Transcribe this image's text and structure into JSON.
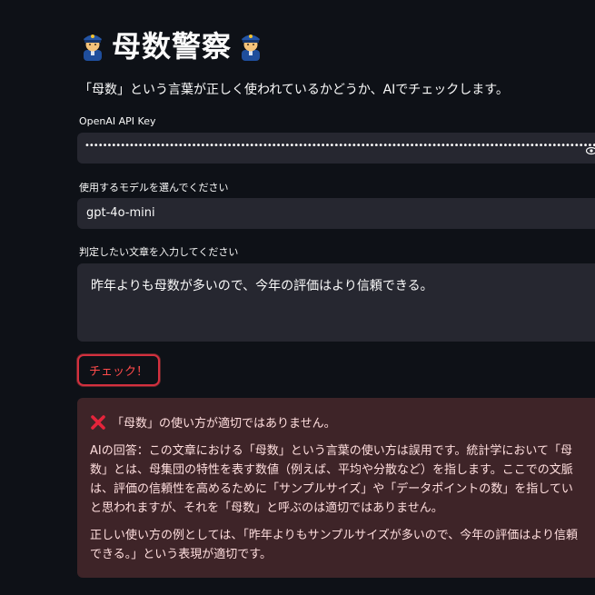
{
  "app": {
    "title": "母数警察",
    "subtitle": "「母数」という言葉が正しく使われているかどうか、AIでチェックします。"
  },
  "api_key": {
    "label": "OpenAI API Key",
    "masked_value": "••••••••••••••••••••••••••••••••••••••••••••••••••••••••••••••••••••••••••••••••••••••••••••••••••••••••••••••••••••••••••••••••••••••••••••••••••••••••••"
  },
  "model": {
    "label": "使用するモデルを選んでください",
    "selected": "gpt-4o-mini"
  },
  "text_input": {
    "label": "判定したい文章を入力してください",
    "value": "昨年よりも母数が多いので、今年の評価はより信頼できる。"
  },
  "check_button": {
    "label": "チェック！"
  },
  "result": {
    "heading": "「母数」の使い方が適切ではありません。",
    "answer": "AIの回答：この文章における「母数」という言葉の使い方は誤用です。統計学において「母\n数」とは、母集団の特性を表す数値（例えば、平均や分散など）を指します。ここでの文脈\nは、評価の信頼性を高めるために「サンプルサイズ」や「データポイントの数」を指してい\nと思われますが、それを「母数」と呼ぶのは適切ではありません。",
    "example": "正しい使い方の例としては、「昨年よりもサンプルサイズが多いので、今年の評価はより信頼\nできる。」という表現が適切です。"
  },
  "colors": {
    "background": "#0e1117",
    "input_bg": "#262730",
    "accent": "#ff4b4b",
    "error_bg": "#3e2428",
    "error_text": "#ffdede"
  },
  "icons": {
    "title_left": "police-officer-icon",
    "title_right": "police-officer-icon",
    "password_toggle": "eye-icon",
    "result_status": "cross-mark-icon"
  }
}
